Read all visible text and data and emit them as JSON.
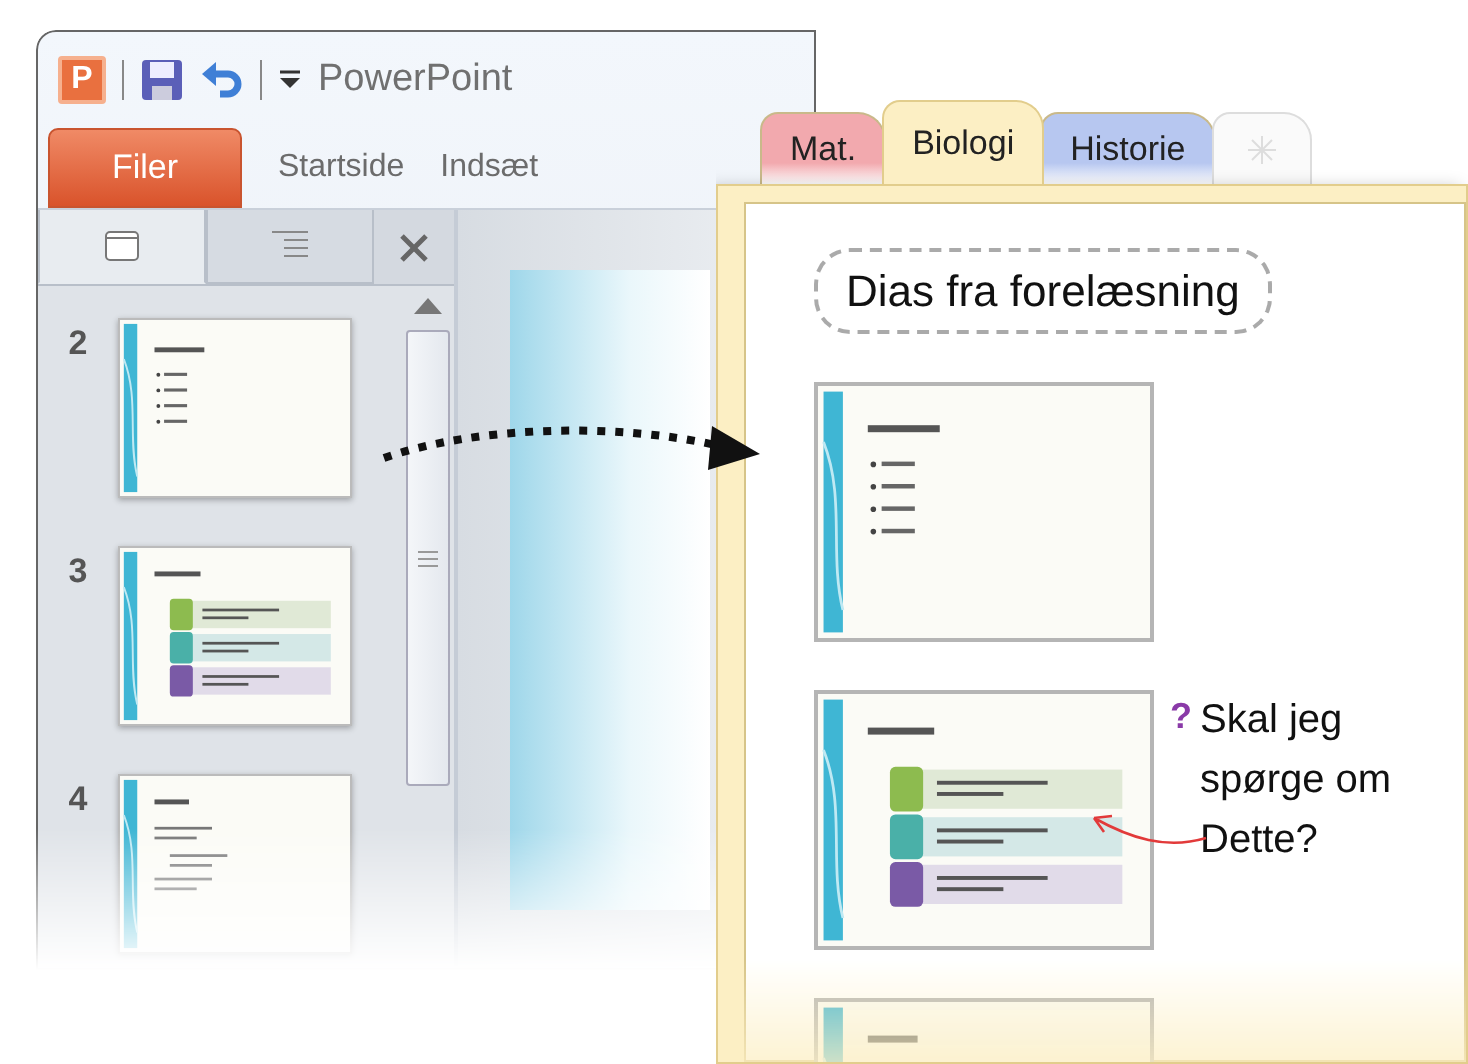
{
  "powerpoint": {
    "logo": "P",
    "title": "PowerPoint",
    "ribbon_tabs": [
      {
        "label": "Filer",
        "kind": "file"
      },
      {
        "label": "Startside",
        "kind": "tab"
      },
      {
        "label": "Indsæt",
        "kind": "tab"
      }
    ],
    "pane_tabs": [
      {
        "kind": "slides",
        "selected": true
      },
      {
        "kind": "outline",
        "selected": false
      }
    ],
    "slides": [
      {
        "number": "2",
        "kind": "bullets"
      },
      {
        "number": "3",
        "kind": "steps"
      },
      {
        "number": "4",
        "kind": "text"
      }
    ]
  },
  "onenote": {
    "section_tabs": [
      {
        "label": "Mat.",
        "color": "#f2a9ae",
        "selected": false
      },
      {
        "label": "Biologi",
        "color": "#fcefc4",
        "selected": true
      },
      {
        "label": "Historie",
        "color": "#b7c7f0",
        "selected": false
      },
      {
        "kind": "new"
      }
    ],
    "page": {
      "title": "Dias fra forelæsning",
      "slides": [
        {
          "kind": "bullets"
        },
        {
          "kind": "steps",
          "note": {
            "tag": "?",
            "text": "Skal jeg spørge om Dette?"
          }
        },
        {
          "kind": "text"
        }
      ]
    }
  }
}
